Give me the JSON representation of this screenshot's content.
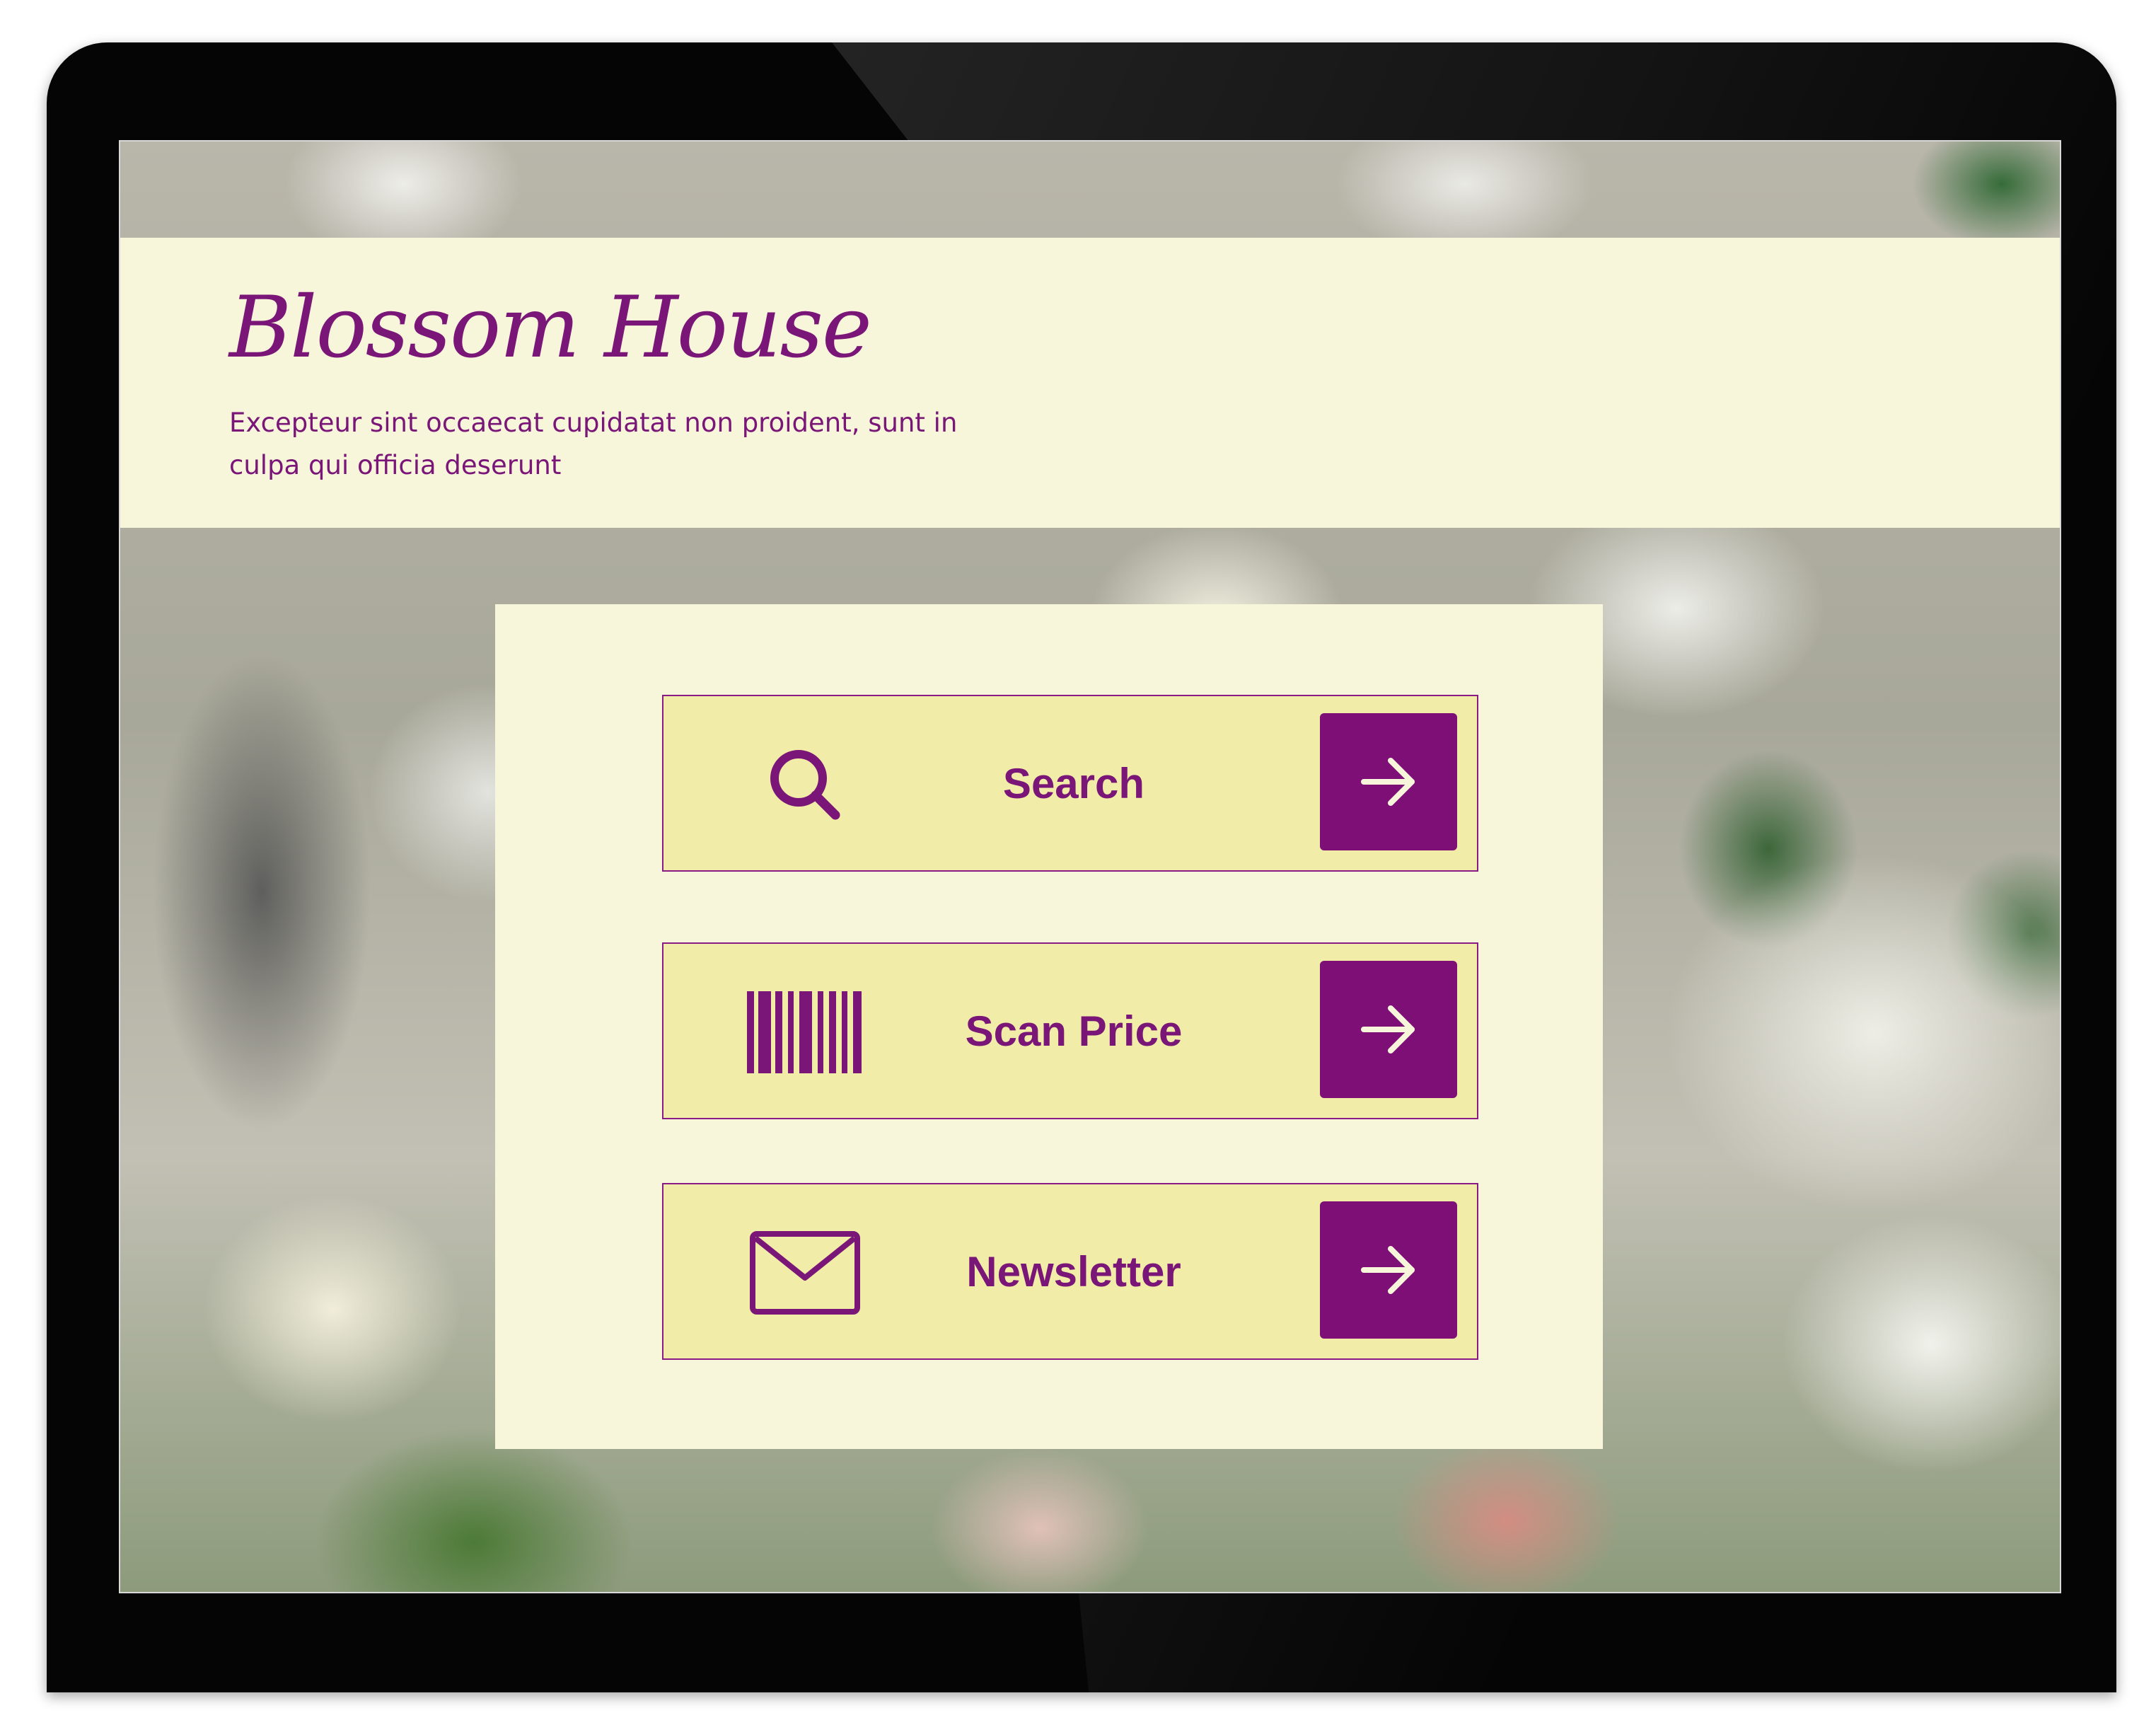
{
  "header": {
    "brand": "Blossom House",
    "tagline": "Excepteur sint occaecat cupidatat non proident, sunt in culpa qui officia deserunt"
  },
  "menu": {
    "items": [
      {
        "label": "Search",
        "icon": "search-icon",
        "action_icon": "arrow-right-icon"
      },
      {
        "label": "Scan Price",
        "icon": "barcode-icon",
        "action_icon": "arrow-right-icon"
      },
      {
        "label": "Newsletter",
        "icon": "envelope-icon",
        "action_icon": "arrow-right-icon"
      }
    ]
  },
  "colors": {
    "accent": "#7a1678",
    "panel": "#f8f6da",
    "tile": "#f1eda8",
    "button": "#7d0f76"
  }
}
